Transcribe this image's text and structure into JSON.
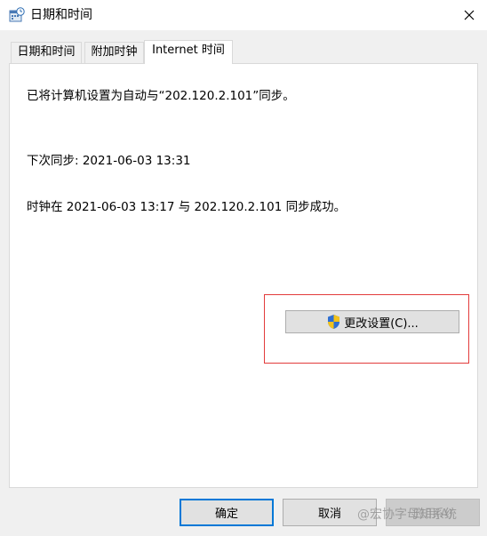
{
  "window": {
    "title": "日期和时间",
    "app_icon": "date-time-icon",
    "close_icon": "close-icon"
  },
  "tabs": [
    {
      "label": "日期和时间",
      "active": false
    },
    {
      "label": "附加时钟",
      "active": false
    },
    {
      "label": "Internet 时间",
      "active": true
    }
  ],
  "panel": {
    "sync_status": "已将计算机设置为自动与“202.120.2.101”同步。",
    "next_sync": "下次同步: 2021-06-03 13:31",
    "last_sync": "时钟在 2021-06-03 13:17 与 202.120.2.101 同步成功。",
    "change_settings_label": "更改设置(C)...",
    "change_settings_icon": "uac-shield-icon"
  },
  "buttons": {
    "ok": "确定",
    "cancel": "取消",
    "apply": "应用(A)"
  },
  "watermark": "@宏协字母知系统",
  "colors": {
    "highlight_border": "#e23b3b",
    "default_button_border": "#0078d7"
  }
}
